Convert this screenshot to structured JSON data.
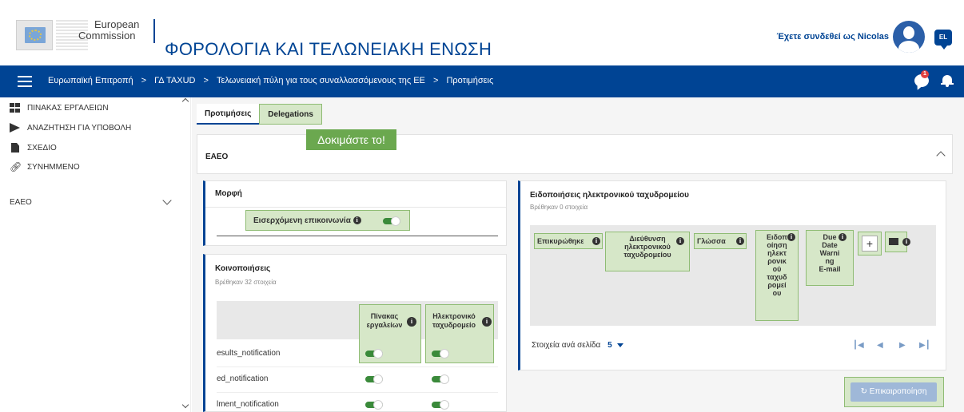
{
  "header": {
    "logo_line1": "European",
    "logo_line2": "Commission",
    "site_title": "ΦΟΡΟΛΟΓΙΑ ΚΑΙ ΤΕΛΩΝΕΙΑΚΗ ΕΝΩΣΗ",
    "user_text": "Έχετε συνδεθεί ως Nicolas",
    "language": "EL"
  },
  "navbar": {
    "breadcrumb": [
      "Ευρωπαϊκή Επιτροπή",
      "ΓΔ TAXUD",
      "Τελωνειακή πύλη για τους συναλλασσόμενους της ΕΕ",
      "Προτιμήσεις"
    ],
    "breadcrumb_sep": ">",
    "notification_count": "1"
  },
  "sidebar": {
    "items": [
      {
        "label": "ΠΙΝΑΚΑΣ ΕΡΓΑΛΕΙΩΝ",
        "icon": "dashboard-icon"
      },
      {
        "label": "ΑΝΑΖΗΤΗΣΗ ΓΙΑ ΥΠΟΒΟΛΗ",
        "icon": "send-icon"
      },
      {
        "label": "ΣΧΕΔΙΟ",
        "icon": "document-icon"
      },
      {
        "label": "ΣΥΝΗΜΜΕΝΟ",
        "icon": "link-icon"
      },
      {
        "label": "EAEO",
        "icon": "chevron-down-icon"
      }
    ]
  },
  "tabs": {
    "preferences": "Προτιμήσεις",
    "delegations": "Delegations"
  },
  "try_it": "Δοκιμάστε το!",
  "eaeo_section": {
    "title": "EAEO"
  },
  "format_card": {
    "title": "Μορφή",
    "incoming_label": "Εισερχόμενη επικοινωνία"
  },
  "notifications_card": {
    "title": "Κοινοποιήσεις",
    "subtitle": "Βρέθηκαν 32 στοιχεία",
    "col_dashboard_1": "Πίνακας",
    "col_dashboard_2": "εργαλείων",
    "col_email_1": "Ηλεκτρονικό",
    "col_email_2": "ταχυδρομείο",
    "rows": [
      "esults_notification",
      "ed_notification",
      "lment_notification"
    ]
  },
  "email_card": {
    "title": "Ειδοποιήσεις ηλεκτρονικού ταχυδρομείου",
    "subtitle": "Βρέθηκαν 0 στοιχεία",
    "col_confirmed": "Επικυρώθηκε",
    "col_address_1": "Διεύθυνση",
    "col_address_2": "ηλεκτρονικού",
    "col_address_3": "ταχυδρομείου",
    "col_language": "Γλώσσα",
    "col_type_lines": [
      "Ειδοπ",
      "οίηση",
      "ηλεκτ",
      "ρονικ",
      "ού",
      "ταχυδ",
      "ρομεί",
      "ου"
    ],
    "col_due_lines": [
      "Due",
      "Date",
      "Warni",
      "ng",
      "E-mail"
    ],
    "items_per_page_label": "Στοιχεία ανά σελίδα",
    "items_per_page_value": "5"
  },
  "refresh_button": "Επικαιροποίηση",
  "colors": {
    "brand_blue": "#004494",
    "highlight_green": "#d6e7c8",
    "try_it_green": "#6ba84f"
  }
}
